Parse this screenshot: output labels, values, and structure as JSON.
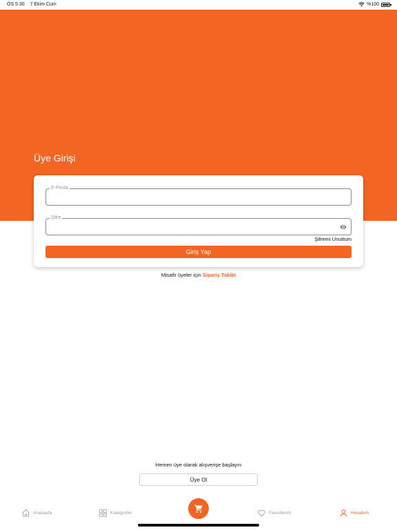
{
  "status_bar": {
    "time": "ÖS 5:30",
    "date": "7 Ekim Cum",
    "battery": "%100"
  },
  "page": {
    "title": "Üye Girişi"
  },
  "login_form": {
    "email_label": "E-Posta",
    "email_value": "",
    "password_label": "Şifre",
    "password_value": "",
    "forgot_label": "Şifremi Unuttum",
    "submit_label": "Giriş Yap"
  },
  "guest": {
    "prefix": "Misafir üyeler için",
    "link_label": "Sipariş Takibi"
  },
  "signup": {
    "prompt": "Hemen üye olarak alışverişe başlayın",
    "button_label": "Üye Ol"
  },
  "tabbar": {
    "home": "Anasayfa",
    "categories": "Kategoriler",
    "favorites": "Favorilerim",
    "account": "Hesabım",
    "active": "account"
  },
  "colors": {
    "brand": "#f26522",
    "background": "#ffffff",
    "muted": "#9a9a9a"
  },
  "icons": [
    "wifi-icon",
    "battery-icon",
    "eye-icon",
    "home-icon",
    "grid-icon",
    "cart-icon",
    "heart-icon",
    "user-icon"
  ]
}
